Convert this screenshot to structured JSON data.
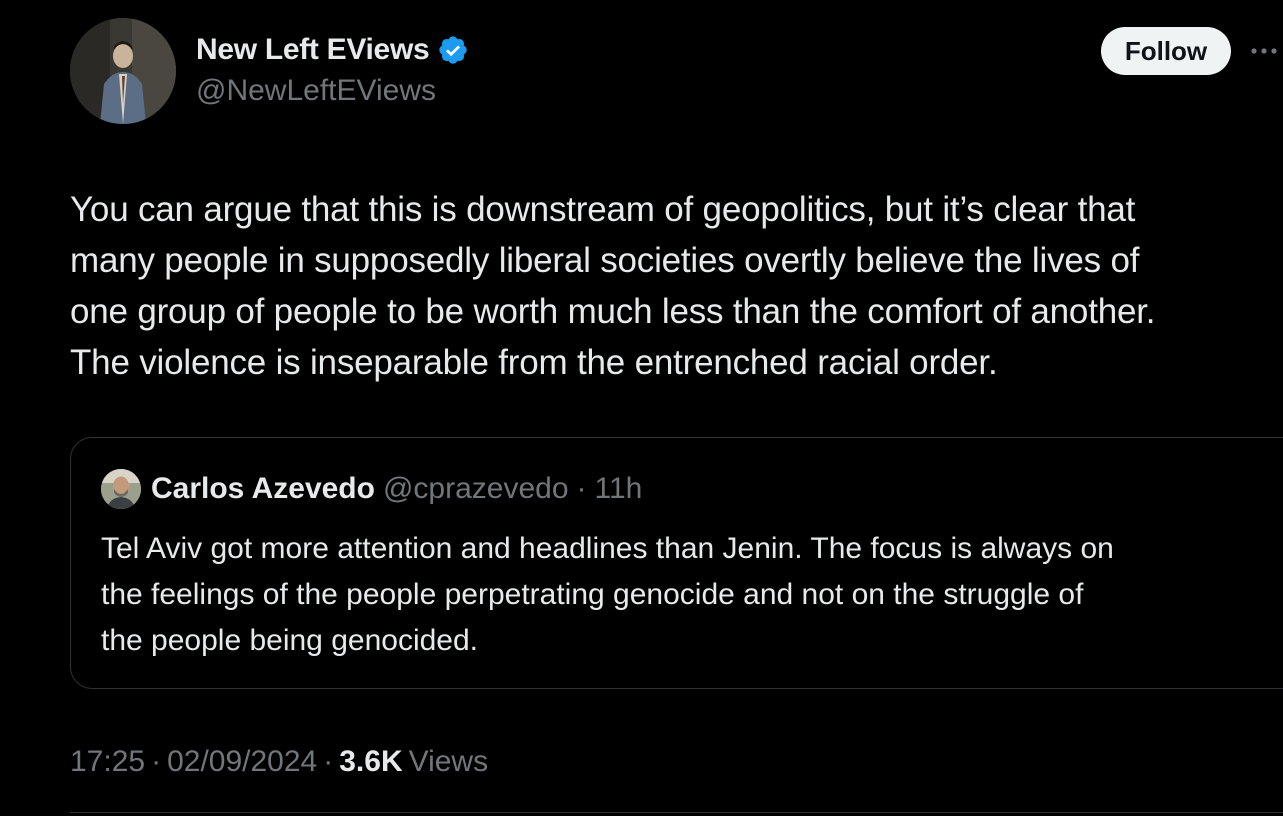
{
  "tweet": {
    "author": {
      "name": "New Left EViews",
      "handle": "@NewLeftEViews",
      "verified": true,
      "avatar_icon": "profile-photo-man-in-suit"
    },
    "follow_label": "Follow",
    "more_icon": "more-dots-icon",
    "text": "You can argue that this is downstream of geopolitics, but it’s clear that\nmany people in supposedly liberal societies overtly believe the lives of\none group of people to be worth much less than the comfort of another.\nThe violence is inseparable from the entrenched racial order.",
    "quote": {
      "author_name": "Carlos Azevedo",
      "handle": "@cprazevedo",
      "separator": "·",
      "time": "11h",
      "avatar_icon": "profile-photo-bald-man",
      "text": "Tel Aviv got more attention and headlines than Jenin. The focus is always on\nthe feelings of the people perpetrating genocide and not on the struggle of\nthe people being genocided."
    },
    "meta": {
      "time": "17:25",
      "dot1": "·",
      "date": "02/09/2024",
      "dot2": "·",
      "views_count": "3.6K",
      "views_label": "Views"
    }
  },
  "colors": {
    "background": "#000000",
    "primary_text": "#e7e9ea",
    "secondary_text": "#71767b",
    "verified_blue": "#1d9bf0",
    "border": "#2f3336",
    "follow_bg": "#eff3f4"
  }
}
